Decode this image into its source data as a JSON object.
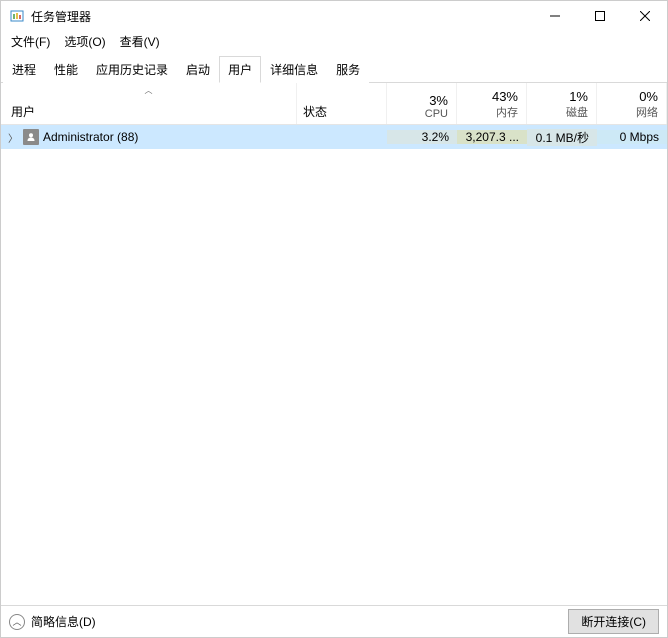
{
  "window": {
    "title": "任务管理器"
  },
  "menubar": {
    "file": "文件(F)",
    "options": "选项(O)",
    "view": "查看(V)"
  },
  "tabs": {
    "processes": "进程",
    "performance": "性能",
    "app_history": "应用历史记录",
    "startup": "启动",
    "users": "用户",
    "details": "详细信息",
    "services": "服务"
  },
  "columns": {
    "user": "用户",
    "status": "状态",
    "cpu_pct": "3%",
    "cpu_label": "CPU",
    "mem_pct": "43%",
    "mem_label": "内存",
    "disk_pct": "1%",
    "disk_label": "磁盘",
    "net_pct": "0%",
    "net_label": "网络"
  },
  "rows": [
    {
      "name": "Administrator (88)",
      "status": "",
      "cpu": "3.2%",
      "mem": "3,207.3 ...",
      "disk": "0.1 MB/秒",
      "net": "0 Mbps"
    }
  ],
  "footer": {
    "fewer_details": "简略信息(D)",
    "disconnect": "断开连接(C)"
  }
}
